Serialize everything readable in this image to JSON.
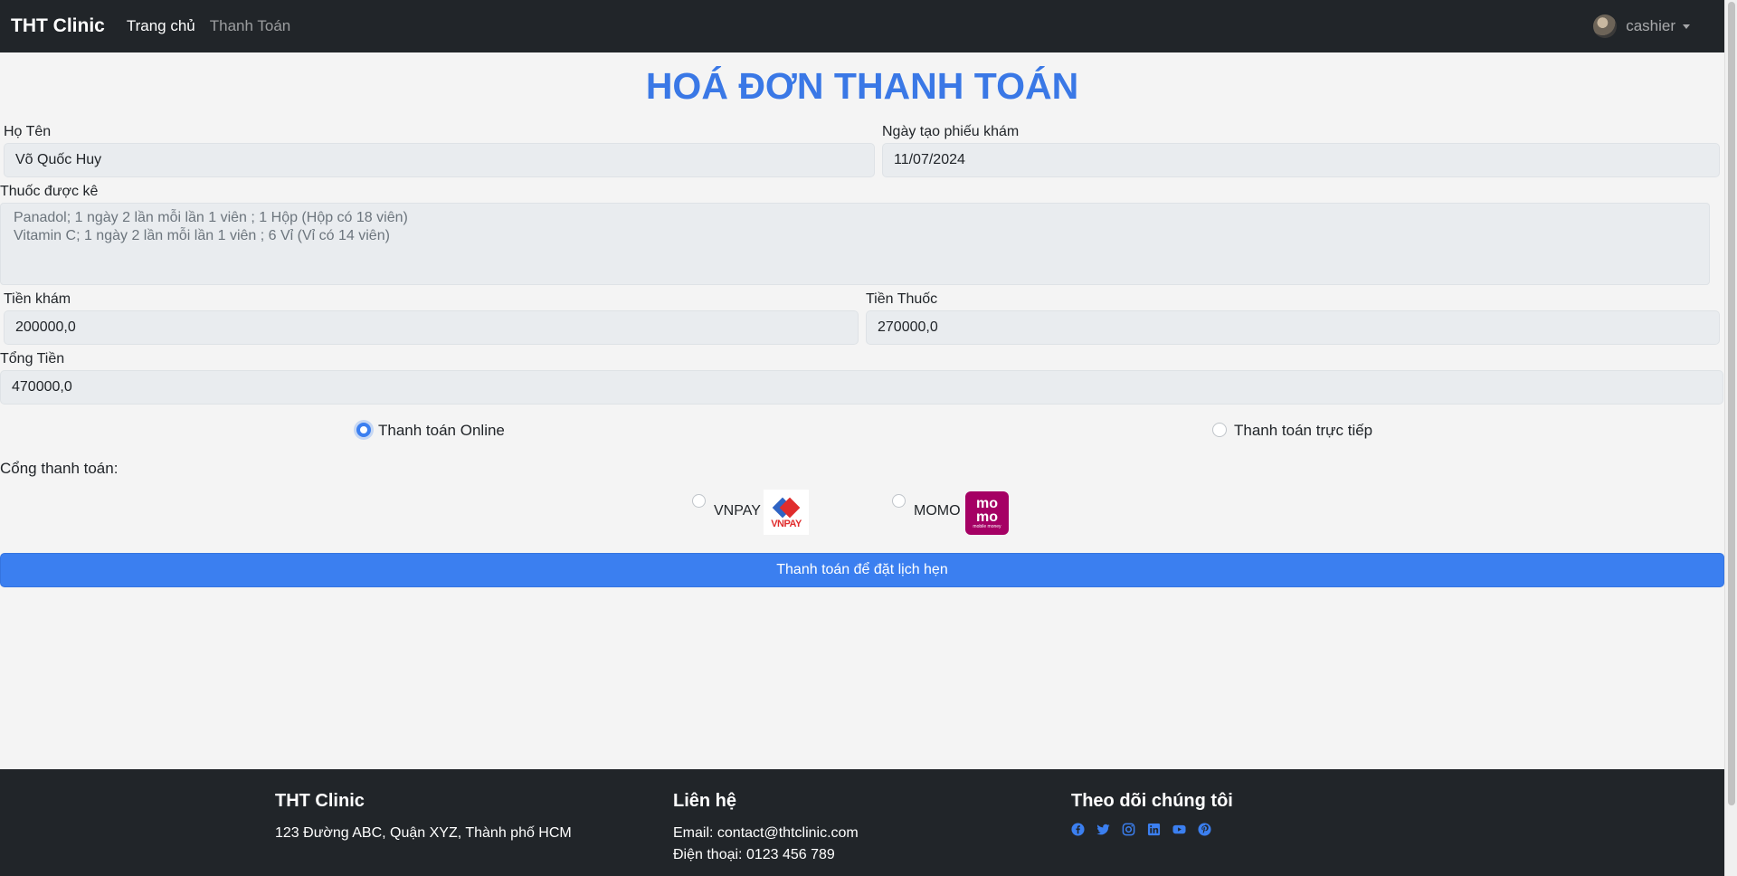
{
  "navbar": {
    "brand": "THT Clinic",
    "links": [
      "Trang chủ",
      "Thanh Toán"
    ],
    "user": "cashier"
  },
  "page_title": "HOÁ ĐƠN THANH TOÁN",
  "form": {
    "name_label": "Họ Tên",
    "name_value": "Võ Quốc Huy",
    "date_label": "Ngày tạo phiếu khám",
    "date_value": "11/07/2024",
    "medicine_label": "Thuốc được kê",
    "medicine_lines": [
      "Panadol; 1 ngày 2 lần mỗi lần 1 viên ; 1 Hộp (Hộp có 18 viên)",
      "Vitamin C; 1 ngày 2 lần mỗi lần 1 viên ; 6 Vỉ (Vỉ có 14 viên)"
    ],
    "exam_fee_label": "Tiền khám",
    "exam_fee_value": "200000,0",
    "medicine_fee_label": "Tiền Thuốc",
    "medicine_fee_value": "270000,0",
    "total_label": "Tổng Tiền",
    "total_value": "470000,0"
  },
  "payment_method": {
    "online_label": "Thanh toán Online",
    "direct_label": "Thanh toán trực tiếp",
    "selected": "online"
  },
  "gateway": {
    "label": "Cổng thanh toán:",
    "vnpay_label": "VNPAY",
    "vnpay_logo_text": "VNPAY",
    "momo_label": "MOMO",
    "momo_logo_top": "mo",
    "momo_logo_bottom": "mo",
    "momo_logo_sub": "mobile money"
  },
  "submit_label": "Thanh toán để đặt lịch hẹn",
  "footer": {
    "col1_title": "THT Clinic",
    "col1_address": "123 Đường ABC, Quận XYZ, Thành phố HCM",
    "col2_title": "Liên hệ",
    "col2_email": "Email: contact@thtclinic.com",
    "col2_phone": "Điện thoại: 0123 456 789",
    "col3_title": "Theo dõi chúng tôi",
    "social_icons": [
      "facebook-icon",
      "twitter-icon",
      "instagram-icon",
      "linkedin-icon",
      "youtube-icon",
      "pinterest-icon"
    ]
  },
  "colors": {
    "accent": "#3b7ff0",
    "title": "#3a78e6",
    "dark": "#212529",
    "momo": "#a50064"
  }
}
